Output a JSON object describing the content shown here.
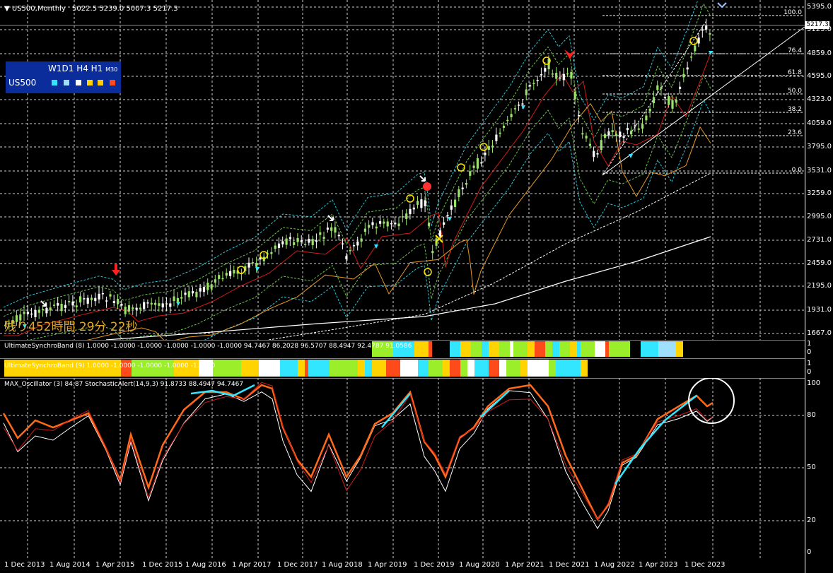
{
  "header": {
    "symbol_tf": "US500,Monthly",
    "ohlc": "5022.5 5239.0 5007.3 5217.3"
  },
  "widget": {
    "timeframes": "W1D1 H4 H1",
    "tf_small": "M30",
    "symbol": "US500",
    "square_colors": [
      "#33e6ff",
      "#a0e0ff",
      "#ffffff",
      "#ffd400",
      "#ffcc00",
      "#ff4a1a"
    ]
  },
  "countdown": "残り452時間 29分 22秒",
  "price_axis": {
    "labels": [
      "5395.0",
      "5123.0",
      "4859.0",
      "4595.0",
      "4323.0",
      "4059.0",
      "3795.0",
      "3531.0",
      "3259.0",
      "2995.0",
      "2731.0",
      "2459.0",
      "2195.0",
      "1931.0",
      "1667.0"
    ],
    "current_price": "5217.3"
  },
  "fibo": {
    "levels": [
      "100.0",
      "76.4",
      "61.8",
      "50.0",
      "38.2",
      "23.6",
      "0.0"
    ]
  },
  "band1": {
    "label": "UltimateSynchroBand (8) 1.0000 -1.0000 -1.0000 -1.0000 -1.0000 -1.0000 94.7467 86.2028 96.5707 88.4947 92.4787 91.0586",
    "scale": [
      "1",
      "0"
    ]
  },
  "band2": {
    "label": "UltimateSynchroBand (9) 1.0000 -1.0000 -1.0000 -1.0000 -1.0000",
    "scale": [
      "1",
      "0"
    ]
  },
  "oscillator": {
    "label": "MAX_Oscillator (3) 84.87   StochasticAlert(14,9,3) 91.8733 88.4947 94.7467",
    "scale": [
      "100",
      "80",
      "50",
      "20",
      "0"
    ]
  },
  "time_axis": [
    "1 Dec 2013",
    "1 Aug 2014",
    "1 Apr 2015",
    "1 Dec 2015",
    "1 Aug 2016",
    "1 Apr 2017",
    "1 Dec 2017",
    "1 Aug 2018",
    "1 Apr 2019",
    "1 Dec 2019",
    "1 Aug 2020",
    "1 Apr 2021",
    "1 Dec 2021",
    "1 Aug 2022",
    "1 Apr 2023",
    "1 Dec 2023"
  ],
  "colors": {
    "bull_candle": "#9ae26a",
    "bear_candle": "#ffffff",
    "ma_red": "#d01a1a",
    "ma_orange": "#e69a28",
    "ma_white": "#ffffff",
    "band_cyan": "#28c8d8",
    "band_green": "#6ac44a",
    "osc_orange": "#ff6a1a",
    "osc_cyan": "#33e6ff",
    "osc_red": "#d01a1a"
  }
}
